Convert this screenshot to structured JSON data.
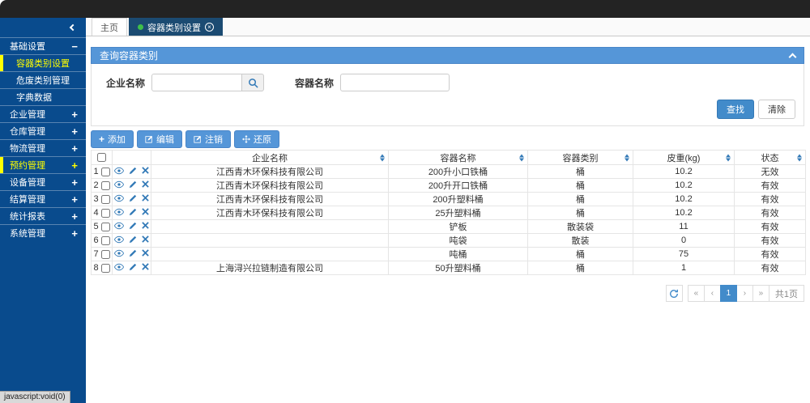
{
  "statusbar": {
    "text": "javascript:void(0)"
  },
  "sidebar": {
    "items": [
      {
        "label": "基础设置",
        "type": "group",
        "suffix": "−",
        "active": false
      },
      {
        "label": "容器类别设置",
        "type": "sub",
        "active": true
      },
      {
        "label": "危废类别管理",
        "type": "sub",
        "active": false
      },
      {
        "label": "字典数据",
        "type": "sub",
        "active": false
      },
      {
        "label": "企业管理",
        "type": "group",
        "suffix": "+",
        "active": false
      },
      {
        "label": "仓库管理",
        "type": "group",
        "suffix": "+",
        "active": false
      },
      {
        "label": "物流管理",
        "type": "group",
        "suffix": "+",
        "active": false
      },
      {
        "label": "预约管理",
        "type": "group",
        "suffix": "+",
        "active": true
      },
      {
        "label": "设备管理",
        "type": "group",
        "suffix": "+",
        "active": false
      },
      {
        "label": "结算管理",
        "type": "group",
        "suffix": "+",
        "active": false
      },
      {
        "label": "统计报表",
        "type": "group",
        "suffix": "+",
        "active": false
      },
      {
        "label": "系统管理",
        "type": "group",
        "suffix": "+",
        "active": false
      }
    ]
  },
  "tabs": {
    "items": [
      {
        "label": "主页",
        "active": false
      },
      {
        "label": "容器类别设置",
        "active": true
      }
    ]
  },
  "panel": {
    "title": "查询容器类别",
    "form": {
      "company_label": "企业名称",
      "company_value": "",
      "container_label": "容器名称",
      "container_value": ""
    },
    "buttons": {
      "search": "查找",
      "clear": "清除"
    }
  },
  "toolbar": {
    "add": "添加",
    "edit": "编辑",
    "cancel": "注销",
    "restore": "还原"
  },
  "table": {
    "columns": [
      "企业名称",
      "容器名称",
      "容器类别",
      "皮重(kg)",
      "状态"
    ],
    "rows": [
      {
        "num": "1",
        "company": "江西青木环保科技有限公司",
        "container": "200升小口铁桶",
        "category": "桶",
        "tare": "10.2",
        "status": "无效"
      },
      {
        "num": "2",
        "company": "江西青木环保科技有限公司",
        "container": "200升开口铁桶",
        "category": "桶",
        "tare": "10.2",
        "status": "有效"
      },
      {
        "num": "3",
        "company": "江西青木环保科技有限公司",
        "container": "200升塑料桶",
        "category": "桶",
        "tare": "10.2",
        "status": "有效"
      },
      {
        "num": "4",
        "company": "江西青木环保科技有限公司",
        "container": "25升塑料桶",
        "category": "桶",
        "tare": "10.2",
        "status": "有效"
      },
      {
        "num": "5",
        "company": "",
        "container": "铲板",
        "category": "散装袋",
        "tare": "11",
        "status": "有效"
      },
      {
        "num": "6",
        "company": "",
        "container": "吨袋",
        "category": "散装",
        "tare": "0",
        "status": "有效"
      },
      {
        "num": "7",
        "company": "",
        "container": "吨桶",
        "category": "桶",
        "tare": "75",
        "status": "有效"
      },
      {
        "num": "8",
        "company": "上海浔兴拉链制造有限公司",
        "container": "50升塑料桶",
        "category": "桶",
        "tare": "1",
        "status": "有效"
      }
    ]
  },
  "pagination": {
    "first": "«",
    "prev": "‹",
    "page": "1",
    "next": "›",
    "last": "»",
    "total": "共1页"
  },
  "colors": {
    "accent": "#428bca",
    "panel_header": "#5596d8",
    "sidebar": "#094b8d",
    "active_item": "#ffff00",
    "tab_active": "#1b4b72",
    "status_green_dot": "#3fbf49"
  }
}
